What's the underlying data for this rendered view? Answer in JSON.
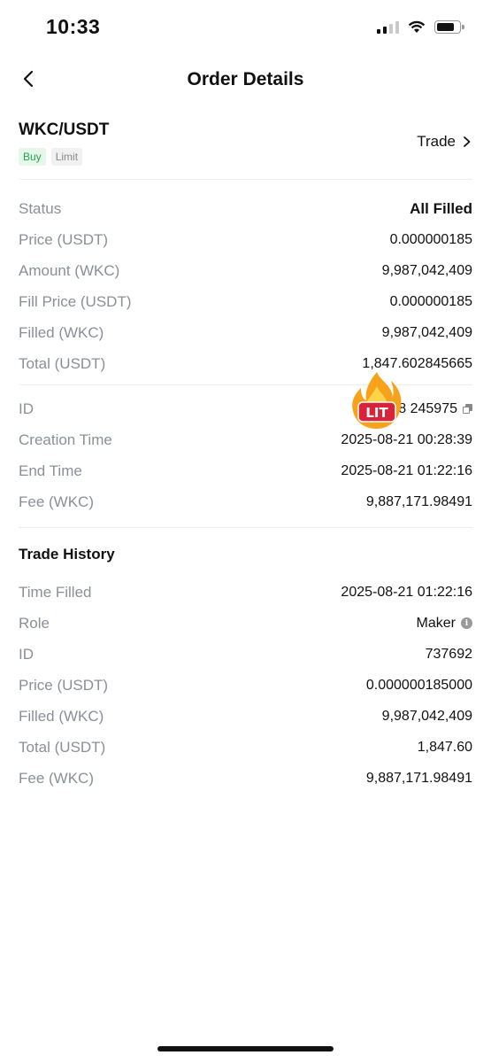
{
  "status_bar": {
    "time": "10:33"
  },
  "nav": {
    "title": "Order Details"
  },
  "order": {
    "pair": "WKC/USDT",
    "side_tag": "Buy",
    "type_tag": "Limit",
    "trade_link": "Trade"
  },
  "details": [
    {
      "label": "Status",
      "value": "All Filled"
    },
    {
      "label": "Price (USDT)",
      "value": "0.000000185"
    },
    {
      "label": "Amount (WKC)",
      "value": "9,987,042,409"
    },
    {
      "label": "Fill Price (USDT)",
      "value": "0.000000185"
    },
    {
      "label": "Filled (WKC)",
      "value": "9,987,042,409"
    },
    {
      "label": "Total (USDT)",
      "value": "1,847.602845665"
    }
  ],
  "meta": [
    {
      "label": "ID",
      "value": "8 245975"
    },
    {
      "label": "Creation Time",
      "value": "2025-08-21 00:28:39"
    },
    {
      "label": "End Time",
      "value": "2025-08-21 01:22:16"
    },
    {
      "label": "Fee (WKC)",
      "value": "9,887,171.98491"
    }
  ],
  "sticker": {
    "text": "LIT"
  },
  "trade_history": {
    "title": "Trade History",
    "rows": [
      {
        "label": "Time Filled",
        "value": "2025-08-21 01:22:16"
      },
      {
        "label": "Role",
        "value": "Maker"
      },
      {
        "label": "ID",
        "value": "737692"
      },
      {
        "label": "Price (USDT)",
        "value": "0.000000185000"
      },
      {
        "label": "Filled (WKC)",
        "value": "9,987,042,409"
      },
      {
        "label": "Total (USDT)",
        "value": "1,847.60"
      },
      {
        "label": "Fee (WKC)",
        "value": "9,887,171.98491"
      }
    ]
  },
  "colors": {
    "buy_green": "#1fa64a",
    "label_gray": "#8a8f99",
    "sticker_orange": "#f7a21b",
    "sticker_red": "#d9233b"
  }
}
